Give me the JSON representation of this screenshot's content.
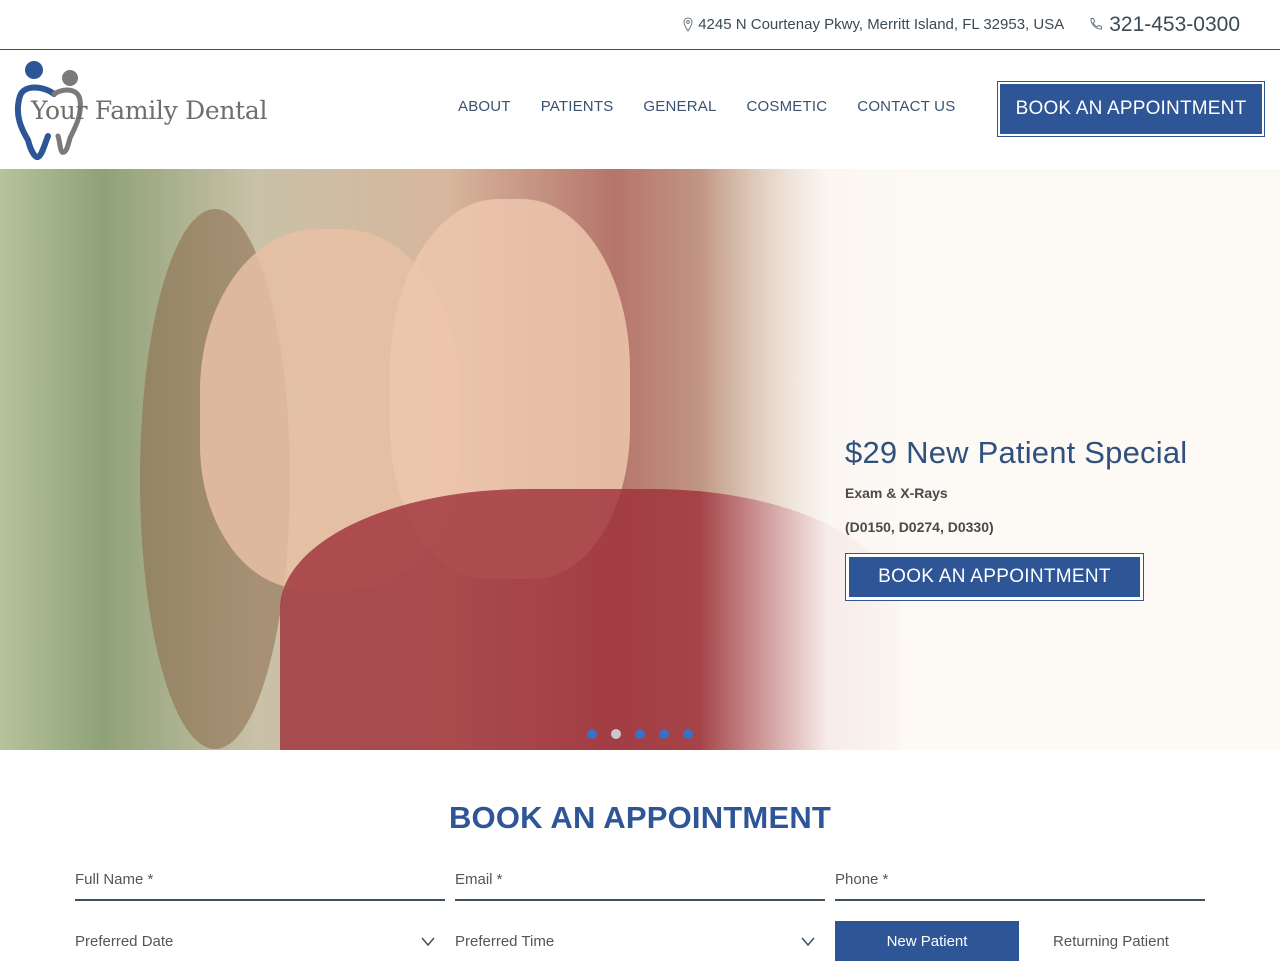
{
  "topbar": {
    "address": "4245 N Courtenay Pkwy, Merritt Island, FL 32953, USA",
    "address_icon": "map-pin-icon",
    "phone": "321-453-0300",
    "phone_icon": "phone-icon"
  },
  "header": {
    "logo_text": "Your Family Dental",
    "nav": [
      {
        "label": "ABOUT"
      },
      {
        "label": "PATIENTS"
      },
      {
        "label": "GENERAL"
      },
      {
        "label": "COSMETIC"
      },
      {
        "label": "CONTACT US"
      }
    ],
    "cta_label": "BOOK AN APPOINTMENT"
  },
  "hero": {
    "title": "$29 New Patient Special",
    "subtitle": "Exam & X-Rays",
    "codes": "(D0150, D0274, D0330)",
    "cta_label": "BOOK AN APPOINTMENT",
    "slides_count": 5,
    "active_slide": 2
  },
  "booking": {
    "title": "BOOK AN APPOINTMENT",
    "fields": {
      "full_name_placeholder": "Full Name *",
      "email_placeholder": "Email *",
      "phone_placeholder": "Phone *",
      "preferred_date": "Preferred Date",
      "preferred_time": "Preferred Time"
    },
    "patient_type": {
      "new_label": "New Patient",
      "returning_label": "Returning Patient",
      "selected": "New Patient"
    }
  },
  "colors": {
    "brand_blue": "#2e5596",
    "nav_text": "#3b5170",
    "logo_gray": "#6e6e6e"
  }
}
